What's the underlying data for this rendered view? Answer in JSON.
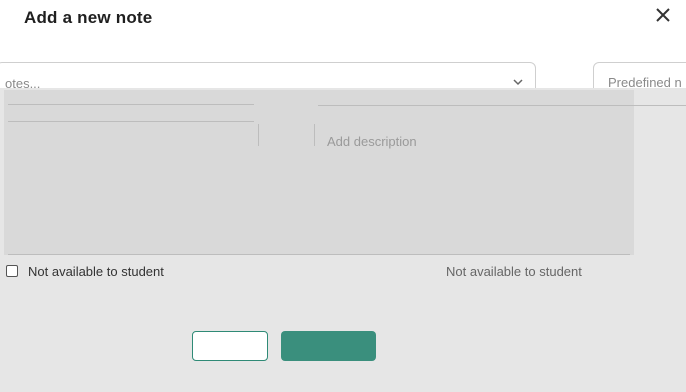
{
  "dialog": {
    "title": "Add a new note",
    "close_label": "×"
  },
  "form": {
    "note_type_value": "otes...",
    "predefined_label": "Predefined n",
    "description_placeholder": "Add description",
    "checkbox_label": "Not available to student",
    "checkbox_label_2": "Not available to student"
  },
  "footer": {
    "meta_text": "",
    "cancel_label": "",
    "save_label": ""
  },
  "colors": {
    "accent": "#3a8f7d",
    "panel": "#d9d9d9"
  }
}
